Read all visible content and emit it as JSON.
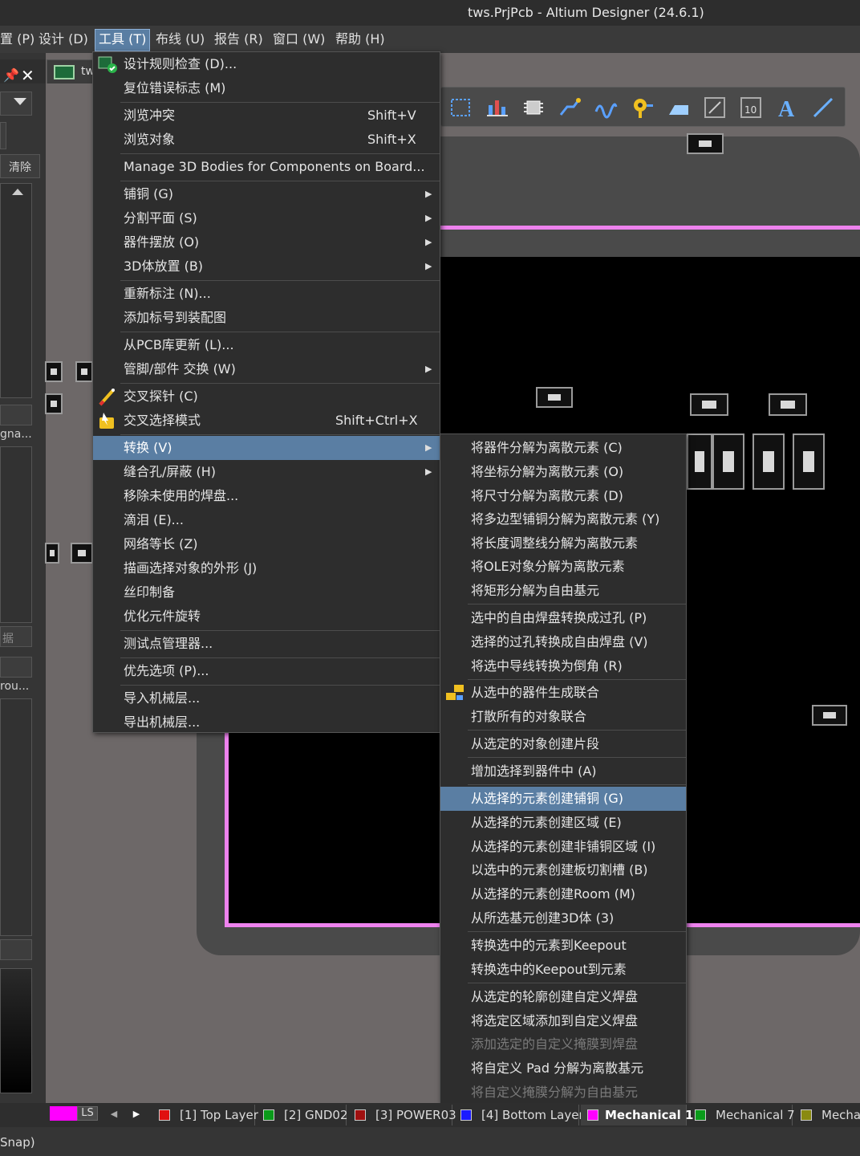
{
  "window": {
    "title": "tws.PrjPcb - Altium Designer (24.6.1)"
  },
  "menubar": {
    "items": [
      {
        "label": "置 (P)"
      },
      {
        "label": "设计 (D)"
      },
      {
        "label": "工具 (T)"
      },
      {
        "label": "布线 (U)"
      },
      {
        "label": "报告 (R)"
      },
      {
        "label": "窗口 (W)"
      },
      {
        "label": "帮助 (H)"
      }
    ]
  },
  "left_panel": {
    "clear_label": "清除",
    "label_a": "gna...",
    "label_b": "rou...",
    "label_c": "据"
  },
  "document_tab": {
    "label": "tw"
  },
  "tools_menu": {
    "items": [
      {
        "label": "设计规则检查 (D)...",
        "shortcut": "",
        "submenu": false
      },
      {
        "label": "复位错误标志 (M)",
        "shortcut": "",
        "submenu": false
      },
      {
        "label": "浏览冲突",
        "shortcut": "Shift+V",
        "submenu": false
      },
      {
        "label": "浏览对象",
        "shortcut": "Shift+X",
        "submenu": false
      },
      {
        "label": "Manage 3D Bodies for Components on Board...",
        "shortcut": "",
        "submenu": false
      },
      {
        "label": "铺铜 (G)",
        "shortcut": "",
        "submenu": true
      },
      {
        "label": "分割平面 (S)",
        "shortcut": "",
        "submenu": true
      },
      {
        "label": "器件摆放 (O)",
        "shortcut": "",
        "submenu": true
      },
      {
        "label": "3D体放置 (B)",
        "shortcut": "",
        "submenu": true
      },
      {
        "label": "重新标注 (N)...",
        "shortcut": "",
        "submenu": false
      },
      {
        "label": "添加标号到装配图",
        "shortcut": "",
        "submenu": false
      },
      {
        "label": "从PCB库更新 (L)...",
        "shortcut": "",
        "submenu": false
      },
      {
        "label": "管脚/部件 交换 (W)",
        "shortcut": "",
        "submenu": true
      },
      {
        "label": "交叉探针 (C)",
        "shortcut": "",
        "submenu": false
      },
      {
        "label": "交叉选择模式",
        "shortcut": "Shift+Ctrl+X",
        "submenu": false
      },
      {
        "label": "转换 (V)",
        "shortcut": "",
        "submenu": true
      },
      {
        "label": "缝合孔/屏蔽 (H)",
        "shortcut": "",
        "submenu": true
      },
      {
        "label": "移除未使用的焊盘...",
        "shortcut": "",
        "submenu": false
      },
      {
        "label": "滴泪 (E)...",
        "shortcut": "",
        "submenu": false
      },
      {
        "label": "网络等长 (Z)",
        "shortcut": "",
        "submenu": false
      },
      {
        "label": "描画选择对象的外形 (J)",
        "shortcut": "",
        "submenu": false
      },
      {
        "label": "丝印制备",
        "shortcut": "",
        "submenu": false
      },
      {
        "label": "优化元件旋转",
        "shortcut": "",
        "submenu": false
      },
      {
        "label": "测试点管理器...",
        "shortcut": "",
        "submenu": false
      },
      {
        "label": "优先选项 (P)...",
        "shortcut": "",
        "submenu": false
      },
      {
        "label": "导入机械层...",
        "shortcut": "",
        "submenu": false
      },
      {
        "label": "导出机械层...",
        "shortcut": "",
        "submenu": false
      }
    ]
  },
  "convert_submenu": {
    "items": [
      {
        "label": "将器件分解为离散元素 (C)"
      },
      {
        "label": "将坐标分解为离散元素 (O)"
      },
      {
        "label": "将尺寸分解为离散元素 (D)"
      },
      {
        "label": "将多边型铺铜分解为离散元素 (Y)"
      },
      {
        "label": "将长度调整线分解为离散元素"
      },
      {
        "label": "将OLE对象分解为离散元素"
      },
      {
        "label": "将矩形分解为自由基元"
      },
      {
        "label": "选中的自由焊盘转换成过孔 (P)"
      },
      {
        "label": "选择的过孔转换成自由焊盘 (V)"
      },
      {
        "label": "将选中导线转换为倒角 (R)"
      },
      {
        "label": "从选中的器件生成联合"
      },
      {
        "label": "打散所有的对象联合"
      },
      {
        "label": "从选定的对象创建片段"
      },
      {
        "label": "增加选择到器件中 (A)"
      },
      {
        "label": "从选择的元素创建铺铜 (G)"
      },
      {
        "label": "从选择的元素创建区域 (E)"
      },
      {
        "label": "从选择的元素创建非铺铜区域 (I)"
      },
      {
        "label": "以选中的元素创建板切割槽 (B)"
      },
      {
        "label": "从选择的元素创建Room (M)"
      },
      {
        "label": "从所选基元创建3D体 (3)"
      },
      {
        "label": "转换选中的元素到Keepout"
      },
      {
        "label": "转换选中的Keepout到元素"
      },
      {
        "label": "从选定的轮廓创建自定义焊盘"
      },
      {
        "label": "将选定区域添加到自定义焊盘"
      },
      {
        "label": "添加选定的自定义掩膜到焊盘"
      },
      {
        "label": "将自定义 Pad 分解为离散基元"
      },
      {
        "label": "将自定义掩膜分解为自由基元"
      }
    ]
  },
  "layer_tabs": {
    "ls_label": "LS",
    "tabs": [
      {
        "label": "[1] Top Layer",
        "color": "#e01010"
      },
      {
        "label": "[2] GND02",
        "color": "#0a9a1a"
      },
      {
        "label": "[3] POWER03",
        "color": "#a01010"
      },
      {
        "label": "[4] Bottom Layer",
        "color": "#1a1aff"
      },
      {
        "label": "Mechanical 1",
        "color": "#ff00ff"
      },
      {
        "label": "Mechanical 7",
        "color": "#0a9a1a"
      },
      {
        "label": "Mechan",
        "color": "#8a8a10"
      }
    ]
  },
  "status": {
    "text": "Snap)"
  },
  "colors": {
    "menu_highlight": "#5a7ea3",
    "board_outline": "#ee82ee",
    "current_layer": "#ff00ff"
  }
}
